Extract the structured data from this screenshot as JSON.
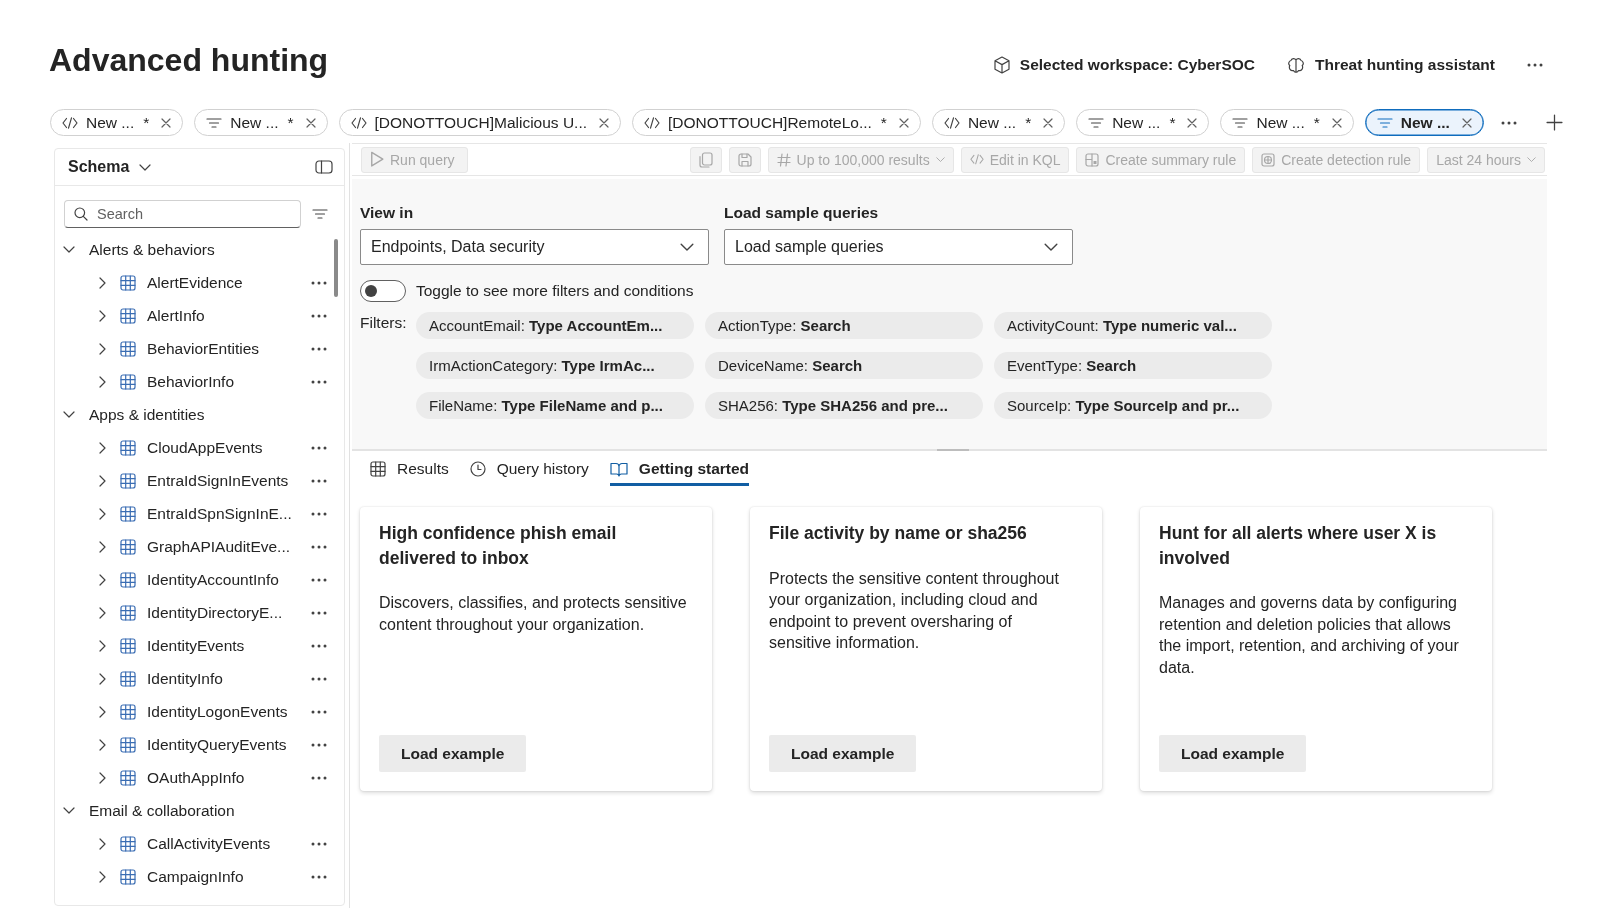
{
  "header": {
    "title": "Advanced hunting",
    "actions": [
      {
        "kind": "workspace",
        "label": "Selected workspace: CyberSOC"
      },
      {
        "kind": "assistant",
        "label": "Threat hunting assistant"
      }
    ]
  },
  "query_tabs": [
    {
      "kind": "code",
      "label": "New ...",
      "marker": "*",
      "selected": false
    },
    {
      "kind": "filter",
      "label": "New ...",
      "marker": "*",
      "selected": false
    },
    {
      "kind": "code",
      "label": "[DONOTTOUCH]Malicious U...",
      "selected": false
    },
    {
      "kind": "code",
      "label": "[DONOTTOUCH]RemoteLo...",
      "marker": "*",
      "selected": false
    },
    {
      "kind": "code",
      "label": "New ...",
      "marker": "*",
      "selected": false
    },
    {
      "kind": "filter",
      "label": "New ...",
      "marker": "*",
      "selected": false
    },
    {
      "kind": "filter",
      "label": "New ...",
      "marker": "*",
      "selected": false
    },
    {
      "kind": "filter",
      "label": "New ...",
      "selected": true
    }
  ],
  "schema": {
    "title": "Schema",
    "search": {
      "placeholder": "Search"
    },
    "tree": [
      {
        "label": "Alerts & behaviors",
        "expanded": true,
        "children": [
          {
            "label": "AlertEvidence",
            "expanded": false
          },
          {
            "label": "AlertInfo",
            "expanded": false
          },
          {
            "label": "BehaviorEntities",
            "expanded": false
          },
          {
            "label": "BehaviorInfo",
            "expanded": false
          }
        ]
      },
      {
        "label": "Apps & identities",
        "expanded": true,
        "children": [
          {
            "label": "CloudAppEvents",
            "expanded": false
          },
          {
            "label": "EntraIdSignInEvents",
            "expanded": false
          },
          {
            "label": "EntraIdSpnSignInE...",
            "expanded": false
          },
          {
            "label": "GraphAPIAuditEve...",
            "expanded": false
          },
          {
            "label": "IdentityAccountInfo",
            "expanded": false
          },
          {
            "label": "IdentityDirectoryE...",
            "expanded": false
          },
          {
            "label": "IdentityEvents",
            "expanded": false
          },
          {
            "label": "IdentityInfo",
            "expanded": false
          },
          {
            "label": "IdentityLogonEvents",
            "expanded": false
          },
          {
            "label": "IdentityQueryEvents",
            "expanded": false
          },
          {
            "label": "OAuthAppInfo",
            "expanded": false
          }
        ]
      },
      {
        "label": "Email & collaboration",
        "expanded": true,
        "children": [
          {
            "label": "CallActivityEvents",
            "expanded": false
          },
          {
            "label": "CampaignInfo",
            "expanded": false
          }
        ]
      }
    ]
  },
  "toolbar": [
    {
      "kind": "run",
      "label": "Run query",
      "disabled": true
    },
    {
      "kind": "copy",
      "disabled": true
    },
    {
      "kind": "save",
      "disabled": true
    },
    {
      "kind": "limit",
      "label": "Up to 100,000 results",
      "disabled": true
    },
    {
      "kind": "kql",
      "label": "Edit in KQL",
      "disabled": true
    },
    {
      "kind": "summary_rule",
      "label": "Create summary rule",
      "disabled": true
    },
    {
      "kind": "detection_rule",
      "label": "Create detection rule",
      "disabled": true
    },
    {
      "kind": "time_range",
      "label": "Last 24 hours",
      "disabled": true
    }
  ],
  "filters_panel": {
    "view_in": {
      "label": "View in",
      "value": "Endpoints, Data security"
    },
    "sample_queries": {
      "label": "Load sample queries",
      "value": "Load sample queries"
    },
    "toggle": {
      "label": "Toggle to see more filters and conditions",
      "on": false
    },
    "filters_label": "Filters:",
    "filters": [
      {
        "text": "AccountEmail: **Type AccountEm...**"
      },
      {
        "text": "ActionType: **Search**"
      },
      {
        "text": "ActivityCount: **Type numeric val...**"
      },
      {
        "text": "IrmActionCategory: **Type IrmAc...**"
      },
      {
        "text": "DeviceName: **Search**"
      },
      {
        "text": "EventType: **Search**"
      },
      {
        "text": "FileName: **Type FileName and p...**"
      },
      {
        "text": "SHA256: **Type SHA256 and pre...**"
      },
      {
        "text": "SourceIp: **Type SourceIp and pr...**"
      }
    ]
  },
  "result_tabs": [
    {
      "kind": "results",
      "label": "Results",
      "selected": false
    },
    {
      "kind": "history",
      "label": "Query history",
      "selected": false
    },
    {
      "kind": "getting_started",
      "label": "Getting started",
      "selected": true
    }
  ],
  "cards": [
    {
      "title": "High confidence phish email delivered to inbox",
      "description": "Discovers, classifies, and protects sensitive content throughout your organization.",
      "button": "Load example"
    },
    {
      "title": "File activity by name or sha256",
      "description": "Protects the sensitive content throughout your organization, including cloud and endpoint to prevent oversharing of sensitive information.",
      "button": "Load example"
    },
    {
      "title": "Hunt for all alerts where user X is involved",
      "description": "Manages and governs data by configuring retention and deletion policies that allows the import, retention, and archiving of your data.",
      "button": "Load example"
    }
  ]
}
